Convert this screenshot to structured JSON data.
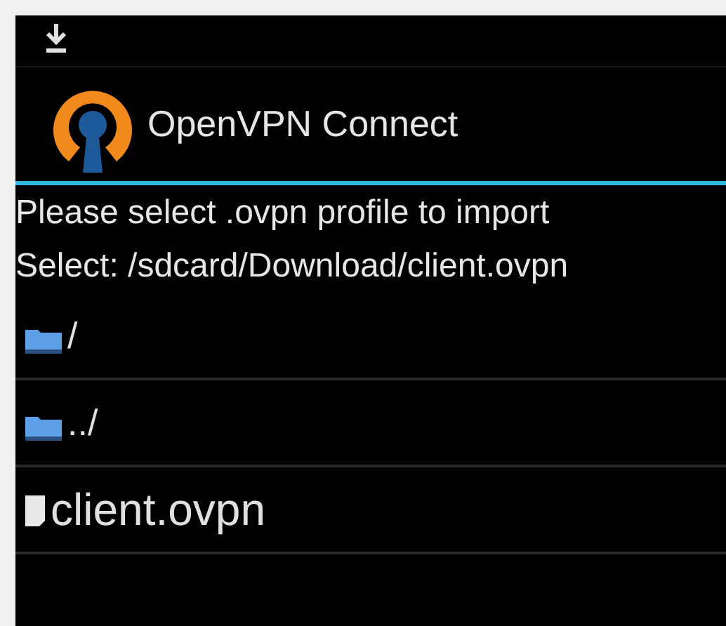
{
  "app_bar": {
    "title": "OpenVPN Connect"
  },
  "prompt": "Please select .ovpn profile to import",
  "selection": "Select: /sdcard/Download/client.ovpn",
  "entries": [
    {
      "kind": "folder",
      "name": "/"
    },
    {
      "kind": "folder",
      "name": "../"
    },
    {
      "kind": "file",
      "name": "client.ovpn"
    }
  ]
}
